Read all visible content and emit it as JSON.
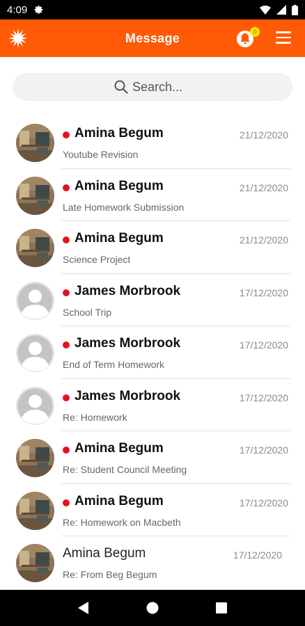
{
  "status_bar": {
    "time": "4:09"
  },
  "app_bar": {
    "title": "Message",
    "notification_count": "0"
  },
  "search": {
    "placeholder": "Search..."
  },
  "messages": [
    {
      "sender": "Amina Begum",
      "date": "21/12/2020",
      "subject": "Youtube Revision",
      "unread": true,
      "avatar": "photo"
    },
    {
      "sender": "Amina Begum",
      "date": "21/12/2020",
      "subject": "Late Homework Submission",
      "unread": true,
      "avatar": "photo"
    },
    {
      "sender": "Amina Begum",
      "date": "21/12/2020",
      "subject": "Science Project",
      "unread": true,
      "avatar": "photo"
    },
    {
      "sender": "James Morbrook",
      "date": "17/12/2020",
      "subject": "School Trip",
      "unread": true,
      "avatar": "placeholder"
    },
    {
      "sender": "James Morbrook",
      "date": "17/12/2020",
      "subject": "End of Term Homework",
      "unread": true,
      "avatar": "placeholder"
    },
    {
      "sender": "James Morbrook",
      "date": "17/12/2020",
      "subject": "Re: Homework",
      "unread": true,
      "avatar": "placeholder"
    },
    {
      "sender": "Amina Begum",
      "date": "17/12/2020",
      "subject": "Re: Student Council Meeting",
      "unread": true,
      "avatar": "photo"
    },
    {
      "sender": "Amina Begum",
      "date": "17/12/2020",
      "subject": "Re: Homework on Macbeth",
      "unread": true,
      "avatar": "photo"
    },
    {
      "sender": "Amina Begum",
      "date": "17/12/2020",
      "subject": "Re: From Beg Begum",
      "unread": false,
      "avatar": "photo"
    }
  ],
  "colors": {
    "accent": "#ff5a05",
    "unread_dot": "#e8101e",
    "badge": "#ffe600"
  },
  "icons": {
    "logo": "sun-logo-icon",
    "notifications": "bell-icon",
    "menu": "hamburger-menu-icon",
    "search": "search-icon",
    "nav_back": "back-triangle-icon",
    "nav_home": "home-circle-icon",
    "nav_recents": "recents-square-icon"
  }
}
